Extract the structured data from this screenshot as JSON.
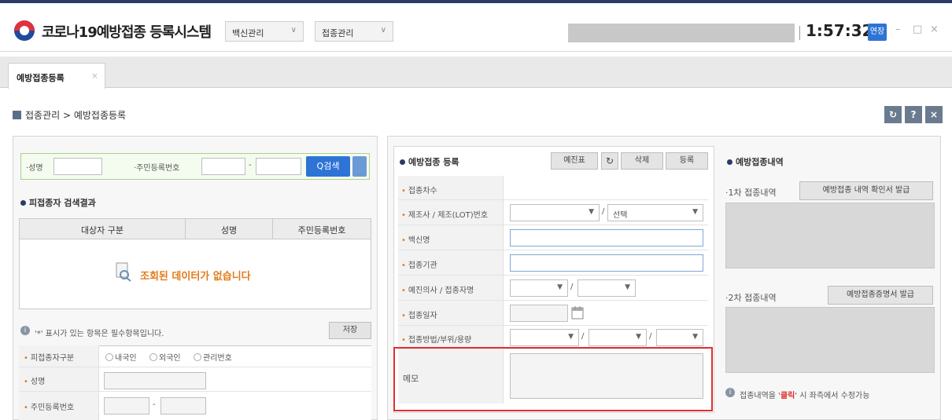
{
  "app": {
    "title": "코로나19예방접종 등록시스템",
    "menu_vaccine": "백신관리",
    "menu_vaccination": "접종관리",
    "clock": "1:57:32",
    "extend_label": "연장",
    "minimize": "–",
    "maximize": "□",
    "close": "×"
  },
  "tabs": [
    {
      "label": "예방접종등록",
      "close": "×"
    }
  ],
  "breadcrumb": {
    "text": "접종관리 > 예방접종등록"
  },
  "top_buttons": {
    "refresh": "↻",
    "help": "?",
    "close": "×"
  },
  "search": {
    "name_label": "·성명",
    "rrn_label": "·주민등록번호",
    "rrn_dash": "-",
    "search_button": "Q검색"
  },
  "results": {
    "title": "피접종자 검색결과",
    "columns": [
      "대상자 구분",
      "성명",
      "주민등록번호"
    ],
    "empty_message": "조회된 데이터가 없습니다"
  },
  "info_form": {
    "notice": "'*' 표시가 있는 항목은 필수항목입니다.",
    "save_button": "저장",
    "fields": {
      "type_label": "피접종자구분",
      "type_options": [
        "내국인",
        "외국인",
        "관리번호"
      ],
      "name_label": "성명",
      "rrn_label": "주민등록번호",
      "rrn_dash": "-"
    }
  },
  "vaccination": {
    "title": "예방접종 등록",
    "buttons": {
      "preview": "예진표",
      "refresh": "↻",
      "delete": "삭제",
      "register": "등록"
    },
    "fields": {
      "dose": "접종차수",
      "lot": "제조사 / 제조(LOT)번호",
      "lot_select": "선택",
      "vaccine": "백신명",
      "institution": "접종기관",
      "doctor": "예진의사 / 접종자명",
      "date": "접종일자",
      "method": "접종방법/부위/용량",
      "memo": "메모"
    },
    "separator": "/"
  },
  "history": {
    "title": "예방접종내역",
    "first_label": "·1차 접종내역",
    "first_button": "예방접종 내역 확인서 발급",
    "second_label": "·2차 접종내역",
    "second_button": "예방접종증명서 발급",
    "footer_prefix": "접종내역을 '",
    "footer_click": "클릭",
    "footer_suffix": "' 시 좌측에서 수정가능"
  },
  "colors": {
    "brand_navy": "#2b3a67",
    "search_blue": "#2e73d6",
    "required_orange": "#e07b1a",
    "highlight_red": "#e03030"
  }
}
